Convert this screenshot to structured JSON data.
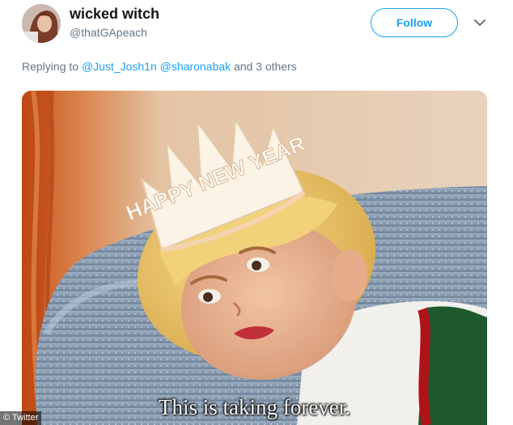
{
  "tweet": {
    "display_name": "wicked witch",
    "handle": "@thatGApeach",
    "follow_label": "Follow",
    "replying_prefix": "Replying to",
    "replying_user1": "@Just_Josh1n",
    "replying_user2": "@sharonabak",
    "replying_suffix": "and 3 others",
    "tiara_text": "HAPPY NEW YEAR",
    "media_caption": "This is taking forever."
  },
  "credit": {
    "text": "© Twitter"
  },
  "icons": {
    "caret": "chevron-down-icon",
    "avatar": "avatar"
  },
  "colors": {
    "brand": "#1da1f2",
    "name": "#14171a",
    "muted": "#657786"
  }
}
